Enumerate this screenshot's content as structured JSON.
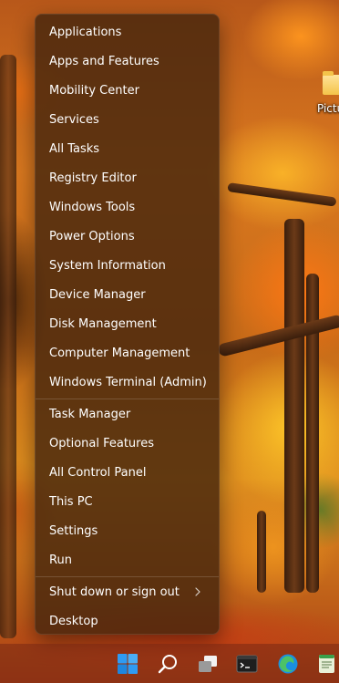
{
  "desktop": {
    "icon_label": "Pictu"
  },
  "menu": {
    "group1": [
      "Applications",
      "Apps and Features",
      "Mobility Center",
      "Services",
      "All Tasks",
      "Registry Editor",
      "Windows Tools",
      "Power Options",
      "System Information",
      "Device Manager",
      "Disk Management",
      "Computer Management",
      "Windows Terminal (Admin)"
    ],
    "group2": [
      "Task Manager",
      "Optional Features",
      "All Control Panel",
      "This PC",
      "Settings",
      "Run"
    ],
    "group3": [
      "Shut down or sign out",
      "Desktop"
    ]
  },
  "taskbar": {
    "icons": [
      "start-icon",
      "search-icon",
      "task-view-icon",
      "terminal-icon",
      "edge-icon",
      "notepad-icon"
    ]
  },
  "colors": {
    "menu_bg": "#46260e",
    "menu_text": "#ffffff",
    "start_blue": "#2f9bf2",
    "edge_blue": "#1b8fe0",
    "edge_green": "#4cc267"
  }
}
